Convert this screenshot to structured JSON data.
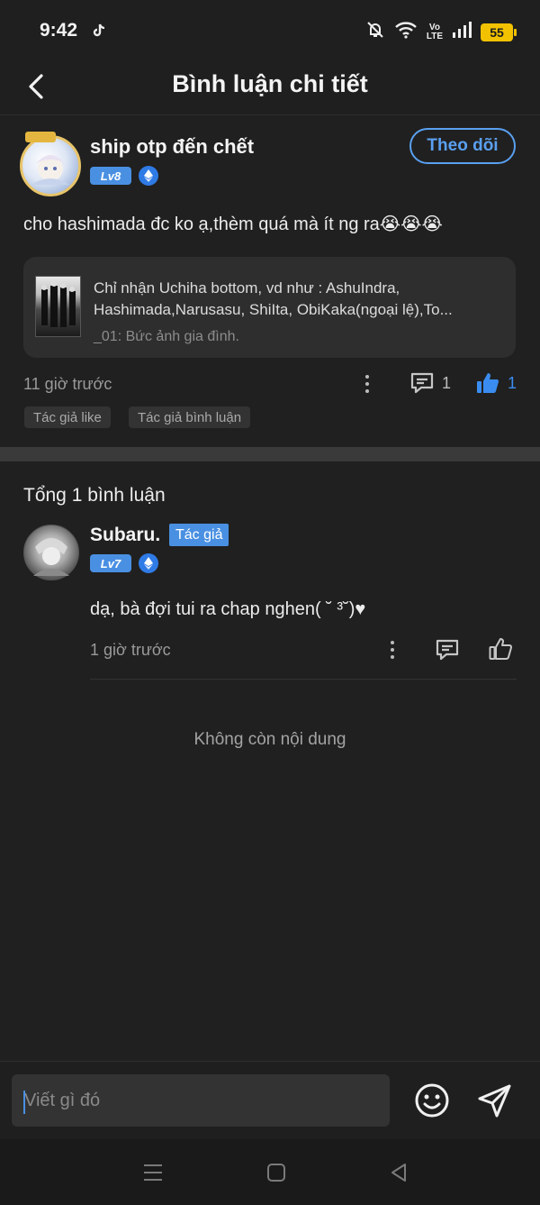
{
  "status_bar": {
    "time": "9:42",
    "battery": "55",
    "network_label_top": "Vo",
    "network_label_bottom": "LTE",
    "icons": [
      "tiktok-icon",
      "mute-icon",
      "wifi-icon",
      "signal-icon",
      "battery-icon"
    ]
  },
  "header": {
    "title": "Bình luận chi tiết",
    "back_icon": "chevron-left-icon"
  },
  "post": {
    "username": "ship otp đến chết",
    "level": "Lv8",
    "follow_label": "Theo dõi",
    "text": "cho hashimada đc ko ạ,thèm quá mà ít ng ra😭😭😭",
    "quote": {
      "line1": "Chỉ nhận Uchiha bottom, vd như : AshuIndra,",
      "line2": "Hashimada,Narusasu, ShiIta, ObiKaka(ngoại lệ),To...",
      "line3": "_01: Bức ảnh gia đình."
    },
    "time": "11 giờ trước",
    "comment_count": "1",
    "like_count": "1",
    "tags": [
      "Tác giả like",
      "Tác giả bình luận"
    ]
  },
  "comments": {
    "total_label": "Tổng 1 bình luận",
    "items": [
      {
        "username": "Subaru.",
        "author_badge": "Tác giả",
        "level": "Lv7",
        "text": "dạ, bà đợi tui ra chap nghen( ˘ ³˘)♥",
        "time": "1 giờ trước"
      }
    ],
    "no_more": "Không còn nội dung"
  },
  "input": {
    "placeholder": "Viết gì đó"
  },
  "colors": {
    "accent": "#4a90e2",
    "background": "#202020",
    "like_active": "#3b8cf0"
  }
}
